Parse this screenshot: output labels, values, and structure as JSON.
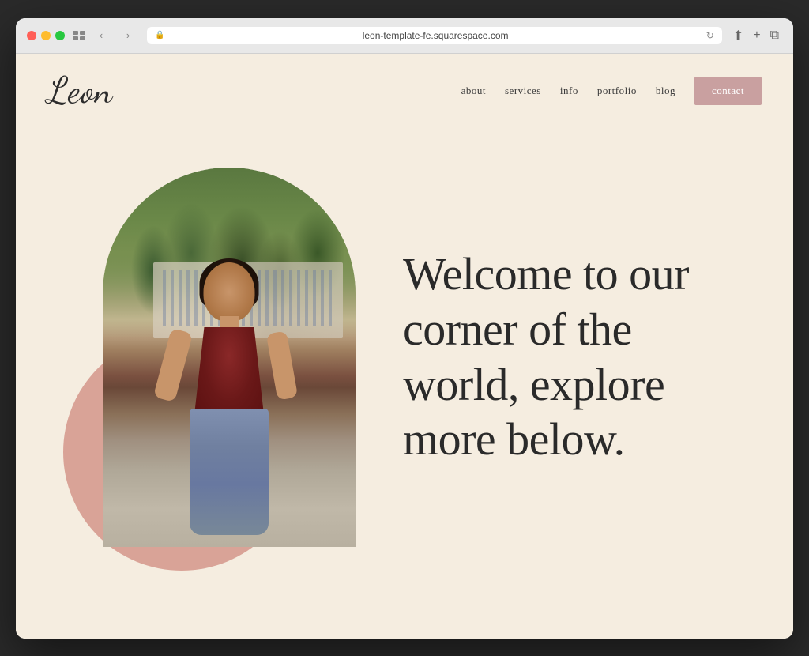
{
  "browser": {
    "url": "leon-template-fe.squarespace.com",
    "back_label": "‹",
    "forward_label": "›"
  },
  "site": {
    "logo": "Leon",
    "nav": {
      "links": [
        {
          "label": "about",
          "id": "about"
        },
        {
          "label": "services",
          "id": "services"
        },
        {
          "label": "info",
          "id": "info"
        },
        {
          "label": "portfolio",
          "id": "portfolio"
        },
        {
          "label": "blog",
          "id": "blog"
        }
      ],
      "contact_label": "contact"
    },
    "hero": {
      "heading": "Welcome to our corner of the world, explore more below."
    },
    "colors": {
      "background": "#f5ede0",
      "pink_circle": "#d4958a",
      "contact_btn": "#c9a0a0",
      "text_dark": "#2a2a2a"
    }
  }
}
